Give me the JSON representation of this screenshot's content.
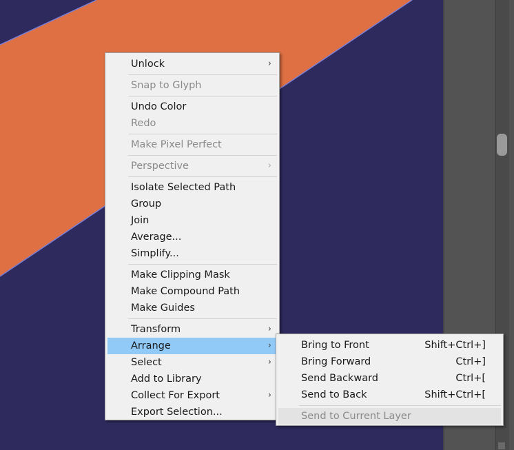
{
  "colors": {
    "canvas_bg": "#2e2a5e",
    "stripe": "#df7043",
    "menu_bg": "#f0f0f0",
    "highlight": "#91c9f7",
    "disabled_text": "#8a8a8a"
  },
  "context_menu": {
    "groups": [
      [
        {
          "label": "Unlock",
          "enabled": true,
          "submenu": true
        }
      ],
      [
        {
          "label": "Snap to Glyph",
          "enabled": false,
          "submenu": false
        }
      ],
      [
        {
          "label": "Undo Color",
          "enabled": true,
          "submenu": false
        },
        {
          "label": "Redo",
          "enabled": false,
          "submenu": false
        }
      ],
      [
        {
          "label": "Make Pixel Perfect",
          "enabled": false,
          "submenu": false
        }
      ],
      [
        {
          "label": "Perspective",
          "enabled": false,
          "submenu": true
        }
      ],
      [
        {
          "label": "Isolate Selected Path",
          "enabled": true,
          "submenu": false
        },
        {
          "label": "Group",
          "enabled": true,
          "submenu": false
        },
        {
          "label": "Join",
          "enabled": true,
          "submenu": false
        },
        {
          "label": "Average...",
          "enabled": true,
          "submenu": false
        },
        {
          "label": "Simplify...",
          "enabled": true,
          "submenu": false
        }
      ],
      [
        {
          "label": "Make Clipping Mask",
          "enabled": true,
          "submenu": false
        },
        {
          "label": "Make Compound Path",
          "enabled": true,
          "submenu": false
        },
        {
          "label": "Make Guides",
          "enabled": true,
          "submenu": false
        }
      ],
      [
        {
          "label": "Transform",
          "enabled": true,
          "submenu": true
        },
        {
          "label": "Arrange",
          "enabled": true,
          "submenu": true,
          "highlighted": true
        },
        {
          "label": "Select",
          "enabled": true,
          "submenu": true
        },
        {
          "label": "Add to Library",
          "enabled": true,
          "submenu": false
        },
        {
          "label": "Collect For Export",
          "enabled": true,
          "submenu": true
        },
        {
          "label": "Export Selection...",
          "enabled": true,
          "submenu": false
        }
      ]
    ]
  },
  "arrange_submenu": {
    "groups": [
      [
        {
          "label": "Bring to Front",
          "shortcut": "Shift+Ctrl+]",
          "enabled": true
        },
        {
          "label": "Bring Forward",
          "shortcut": "Ctrl+]",
          "enabled": true
        },
        {
          "label": "Send Backward",
          "shortcut": "Ctrl+[",
          "enabled": true
        },
        {
          "label": "Send to Back",
          "shortcut": "Shift+Ctrl+[",
          "enabled": true
        }
      ],
      [
        {
          "label": "Send to Current Layer",
          "shortcut": "",
          "enabled": false,
          "hover": true
        }
      ]
    ]
  },
  "icons": {
    "submenu_arrow": "chevron-right-icon",
    "submenu_arrow_glyph": "›"
  }
}
